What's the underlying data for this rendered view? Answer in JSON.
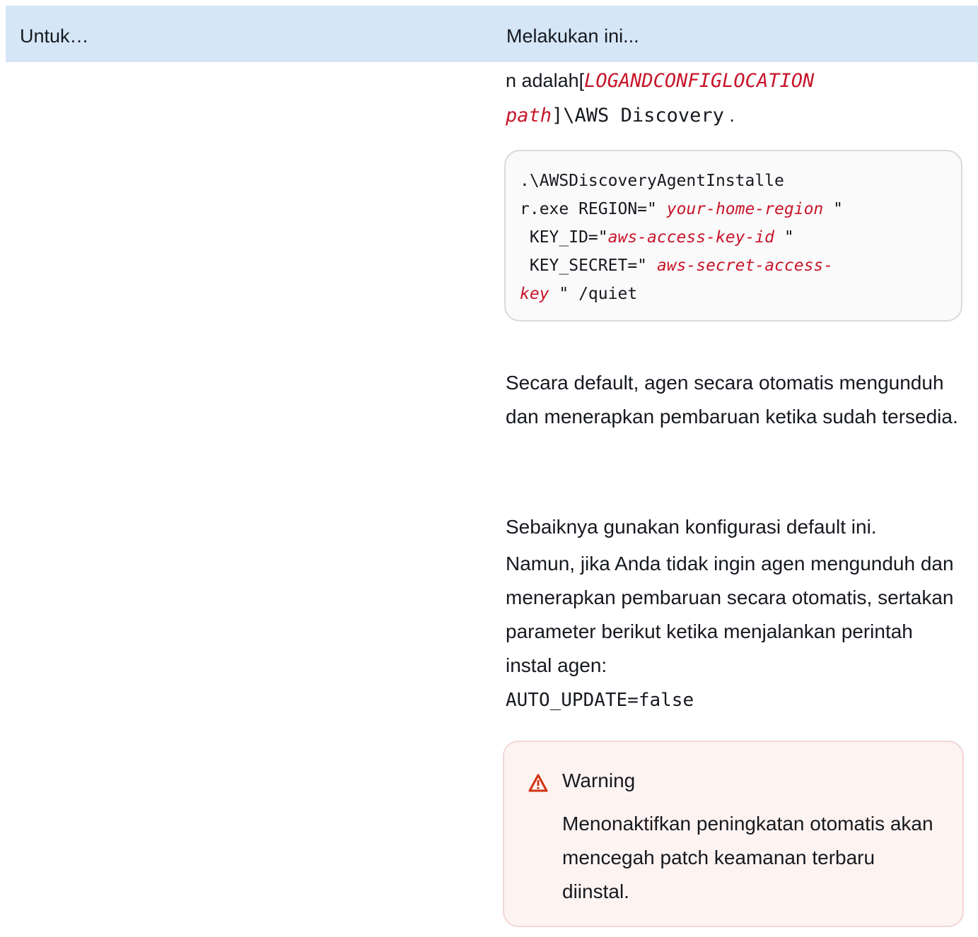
{
  "table": {
    "header": {
      "col1": "Untuk…",
      "col2": "Melakukan ini..."
    }
  },
  "path_line": {
    "prefix": "n adalah[",
    "var1": "LOGANDCONFIGLOCATION",
    "var2": "path",
    "suffix": "]\\AWS Discovery",
    "end": " ."
  },
  "code": {
    "line1": ".\\AWSDiscoveryAgentInstalle",
    "line2_a": "r.exe REGION=\" ",
    "line2_var": "your-home-region",
    "line2_b": " \"",
    "line3_a": " KEY_ID=\"",
    "line3_var": "aws-access-key-id",
    "line3_b": " \"",
    "line4_a": " KEY_SECRET=\" ",
    "line4_var": "aws-secret-access-",
    "line5_var": "key",
    "line5_b": " \" /quiet"
  },
  "paragraphs": {
    "p1": "Secara default, agen secara otomatis mengunduh dan menerapkan pembaruan ketika sudah tersedia.",
    "p2": "Sebaiknya gunakan konfigurasi default ini.",
    "p3": "Namun, jika Anda tidak ingin agen mengunduh dan menerapkan pembaruan secara otomatis, sertakan parameter berikut ketika menjalankan perintah instal agen:",
    "p3_code": "AUTO_UPDATE=false"
  },
  "warning": {
    "icon": "warning-triangle-icon",
    "title": "Warning",
    "body": "Menonaktifkan peningkatan otomatis akan mencegah patch keamanan terbaru diinstal."
  },
  "colors": {
    "header_bg": "#d5e6f7",
    "variable": "#c7162b",
    "warning_bg": "#fdf3f1",
    "warning_icon": "#d13212"
  }
}
